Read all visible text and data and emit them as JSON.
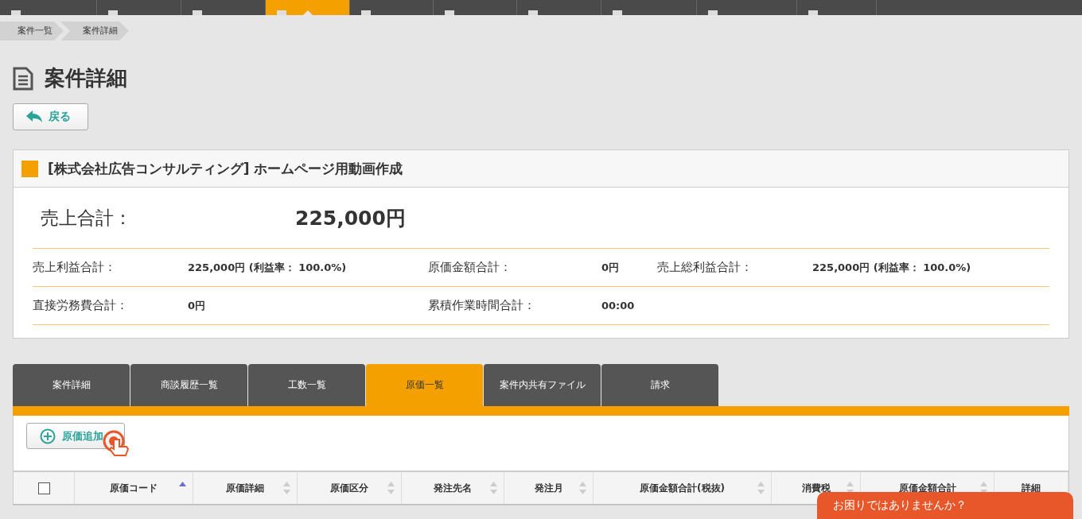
{
  "top_nav": {
    "items": [
      {
        "selected": false
      },
      {
        "selected": false
      },
      {
        "selected": false
      },
      {
        "selected": true
      },
      {
        "selected": false
      },
      {
        "selected": false
      },
      {
        "selected": false
      },
      {
        "selected": false
      },
      {
        "selected": false
      },
      {
        "selected": false
      }
    ]
  },
  "breadcrumb": [
    "案件一覧",
    "案件詳細"
  ],
  "page_title": "案件詳細",
  "back_button": "戻る",
  "project": {
    "title": "[株式会社広告コンサルティング] ホームページ用動画作成",
    "color": "#f3a000",
    "sales_total": {
      "label": "売上合計：",
      "value": "225,000円"
    },
    "rows": [
      [
        {
          "label": "売上利益合計：",
          "value": "225,000円 (利益率： 100.0%)"
        },
        {
          "label": "原価金額合計：",
          "value": "0円"
        },
        {
          "label": "売上総利益合計：",
          "value": "225,000円 (利益率： 100.0%)"
        }
      ],
      [
        {
          "label": "直接労務費合計：",
          "value": "0円"
        },
        {
          "label": "累積作業時間合計：",
          "value": "00:00"
        }
      ]
    ]
  },
  "tabs": [
    {
      "label": "案件詳細",
      "selected": false
    },
    {
      "label": "商談履歴一覧",
      "selected": false
    },
    {
      "label": "工数一覧",
      "selected": false
    },
    {
      "label": "原価一覧",
      "selected": true
    },
    {
      "label": "案件内共有ファイル",
      "selected": false
    },
    {
      "label": "請求",
      "selected": false
    }
  ],
  "add_button": "原価追加",
  "table": {
    "select_all": {
      "checked": false
    },
    "columns": [
      {
        "label": "原価コード",
        "sorted": true
      },
      {
        "label": "原価詳細",
        "sorted": false
      },
      {
        "label": "原価区分",
        "sorted": false
      },
      {
        "label": "発注先名",
        "sorted": false
      },
      {
        "label": "発注月",
        "sorted": false
      },
      {
        "label": "原価金額合計(税抜)",
        "sorted": false
      },
      {
        "label": "消費税",
        "sorted": false
      },
      {
        "label": "原価金額合計",
        "sorted": false
      },
      {
        "label": "詳細"
      }
    ]
  },
  "help_button": "お困りではありませんか？"
}
